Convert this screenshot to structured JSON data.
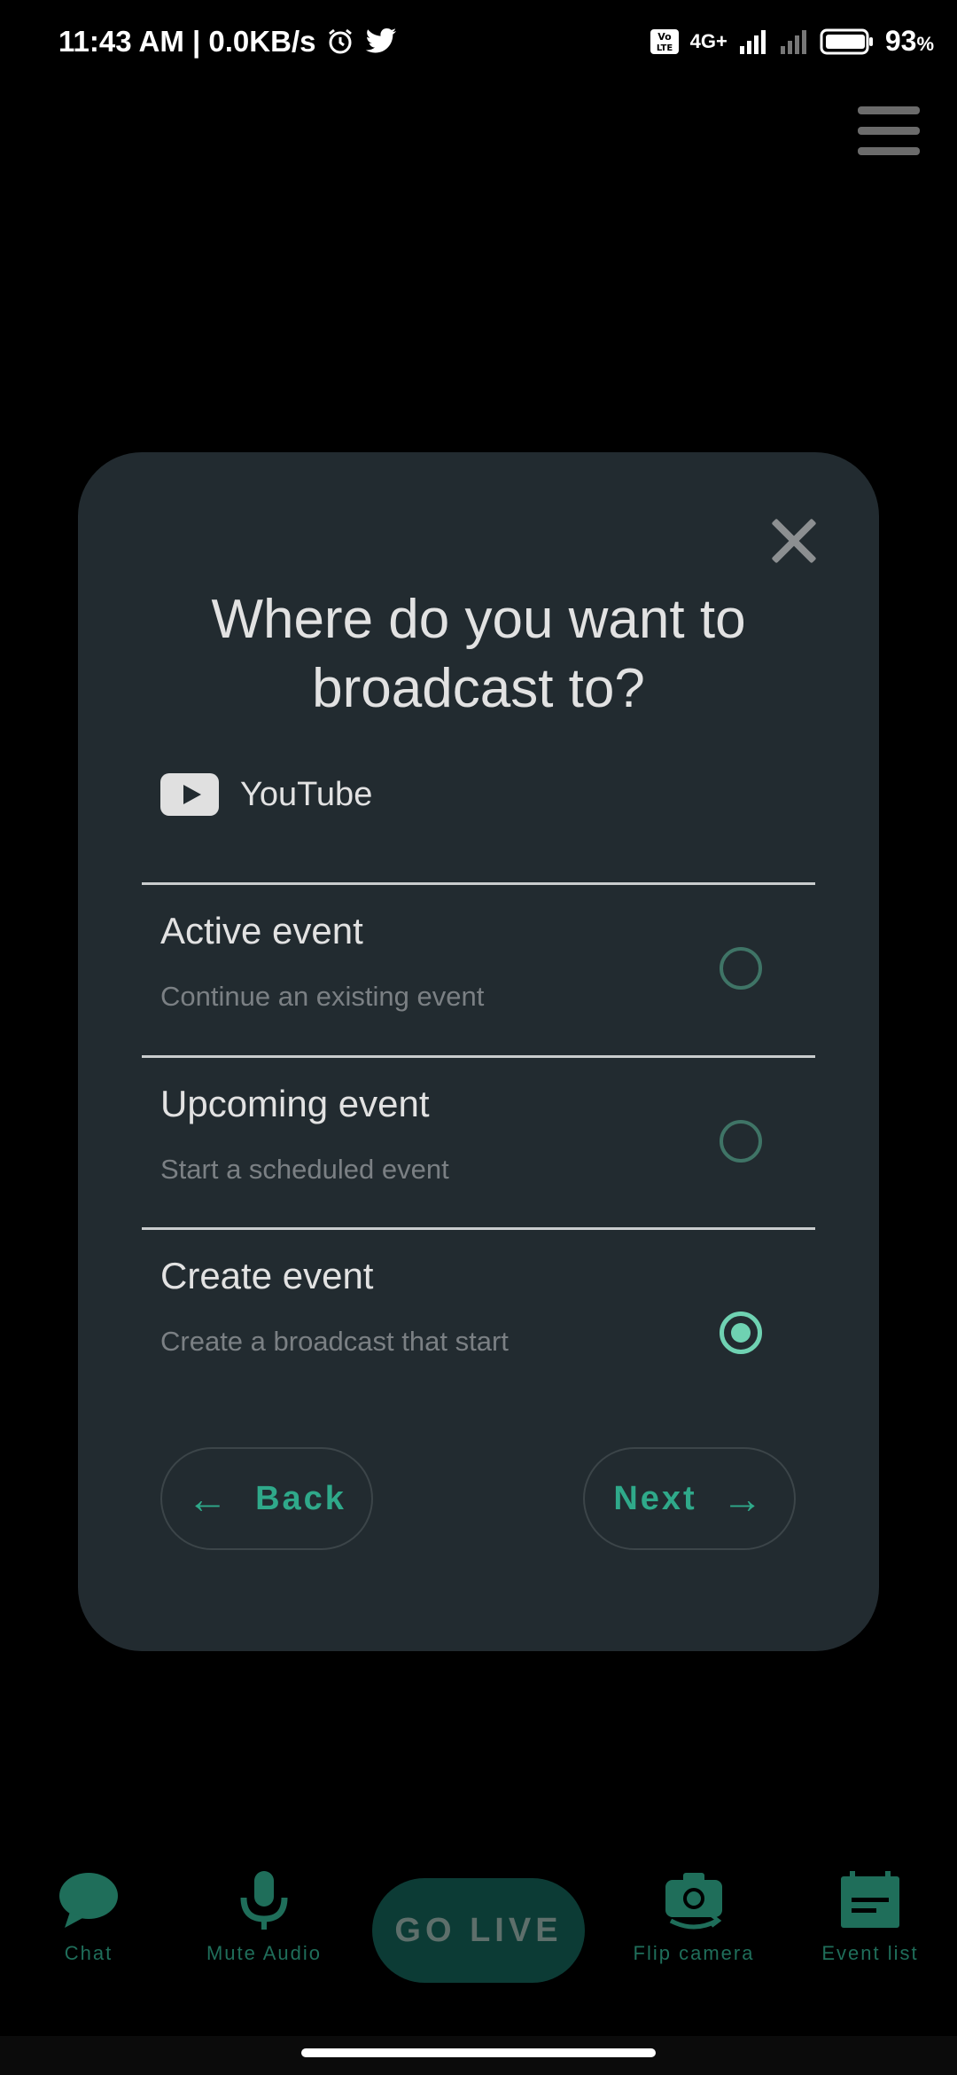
{
  "status_bar": {
    "time_info": "11:43 AM | 0.0KB/s",
    "network": "4G+",
    "battery": "93",
    "battery_unit": "%"
  },
  "dialog": {
    "title_line1": "Where do you want to",
    "title_line2": "broadcast to?",
    "platform": "YouTube",
    "options": [
      {
        "title": "Active event",
        "subtitle": "Continue an existing event",
        "selected": false
      },
      {
        "title": "Upcoming event",
        "subtitle": "Start a scheduled event",
        "selected": false
      },
      {
        "title": "Create event",
        "subtitle": "Create a broadcast that start",
        "selected": true
      }
    ],
    "back_label": "Back",
    "next_label": "Next"
  },
  "bottom_nav": {
    "chat": "Chat",
    "mute_audio": "Mute Audio",
    "go_live": "GO LIVE",
    "flip_camera": "Flip camera",
    "event_list": "Event list"
  },
  "colors": {
    "accent": "#2fa98a",
    "dialog_bg": "#222b30",
    "radio_selected": "#6fd2b2"
  }
}
